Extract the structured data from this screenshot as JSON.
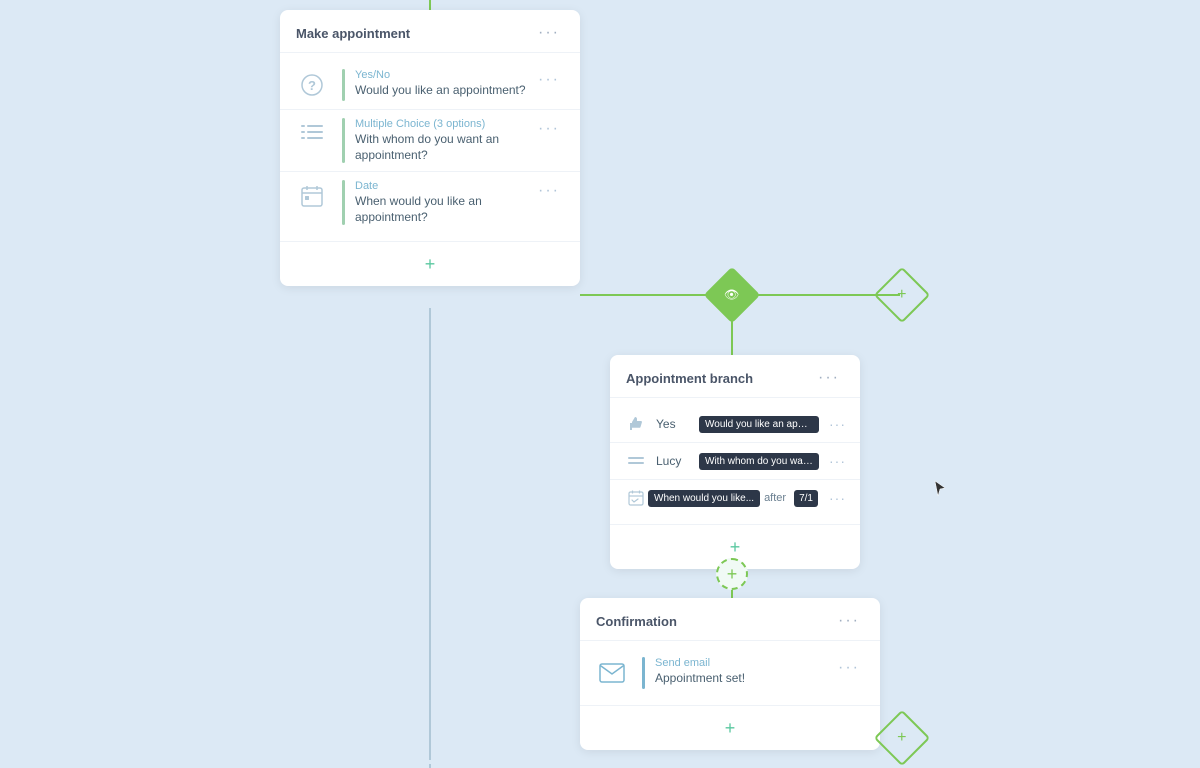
{
  "makeAppointment": {
    "title": "Make appointment",
    "rows": [
      {
        "type": "yes_no",
        "label": "Yes/No",
        "text": "Would you like an appointment?",
        "icon": "question-icon"
      },
      {
        "type": "multiple_choice",
        "label": "Multiple Choice (3 options)",
        "text": "With whom do you want an appointment?",
        "icon": "list-icon"
      },
      {
        "type": "date",
        "label": "Date",
        "text": "When would you like an appointment?",
        "icon": "calendar-icon"
      }
    ]
  },
  "appointmentBranch": {
    "title": "Appointment branch",
    "rows": [
      {
        "icon": "thumbs-up-icon",
        "label": "Yes",
        "tag": "Would you like an appointmen",
        "after": null,
        "num": null
      },
      {
        "icon": "equals-icon",
        "label": "Lucy",
        "tag": "With whom do you want an",
        "after": null,
        "num": null
      },
      {
        "icon": "calendar-icon",
        "label": "",
        "tag": "When would you like...",
        "after": "after",
        "num": "7/1"
      }
    ]
  },
  "confirmation": {
    "title": "Confirmation",
    "rows": [
      {
        "type": "send_email",
        "label": "Send email",
        "text": "Appointment set!",
        "icon": "email-icon"
      }
    ]
  },
  "diamonds": {
    "main_label": "👁",
    "right_label": "+"
  },
  "colors": {
    "green": "#7dc855",
    "green_outline": "#7dc855",
    "background": "#dce9f5"
  }
}
